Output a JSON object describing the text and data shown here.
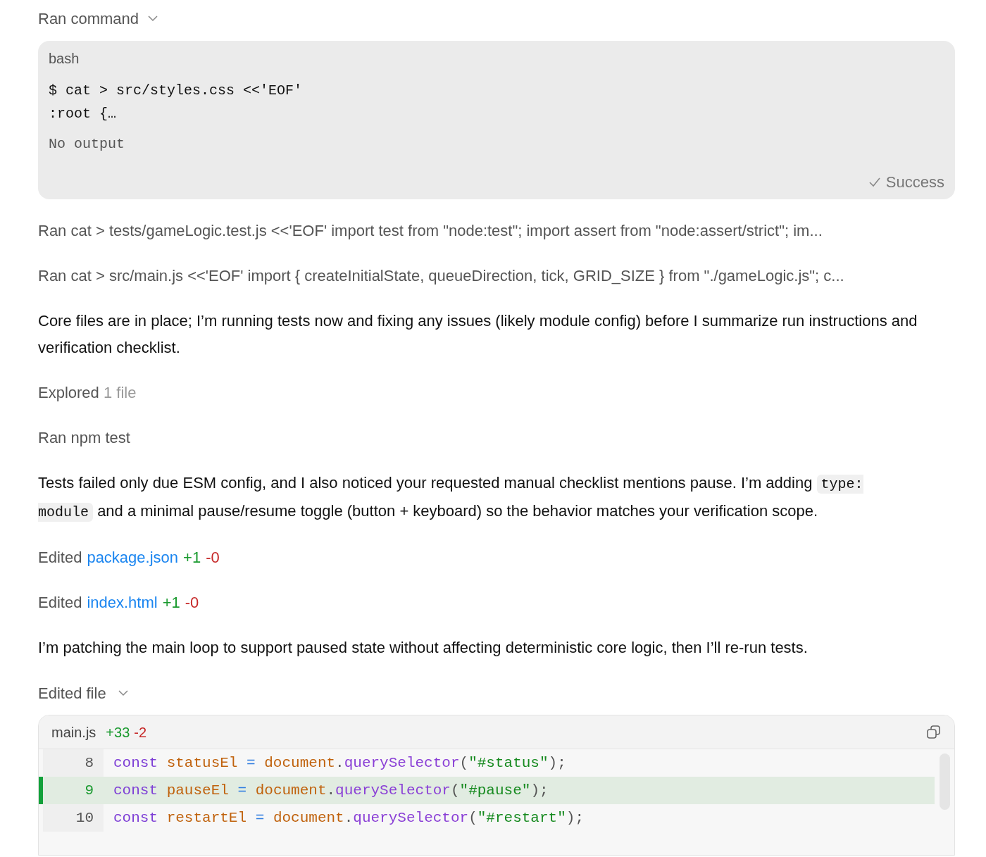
{
  "entries": [
    {
      "kind": "command",
      "header": "Ran command",
      "expanded": true,
      "language": "bash",
      "code_lines": [
        "$ cat > src/styles.css <<'EOF'",
        ":root {…"
      ],
      "output": "No output",
      "status": "Success"
    },
    {
      "kind": "summary",
      "text": "Ran cat > tests/gameLogic.test.js <<'EOF' import test from \"node:test\"; import assert from \"node:assert/strict\"; im..."
    },
    {
      "kind": "summary",
      "text": "Ran cat > src/main.js <<'EOF' import { createInitialState, queueDirection, tick, GRID_SIZE } from \"./gameLogic.js\"; c..."
    },
    {
      "kind": "message",
      "segments": [
        {
          "kind": "text",
          "text": "Core files are in place; I’m running tests now and fixing any issues (likely module config) before I summarize run instructions and verification checklist."
        }
      ]
    },
    {
      "kind": "explored",
      "verb": "Explored",
      "detail": "1 file"
    },
    {
      "kind": "summary",
      "text": "Ran npm test"
    },
    {
      "kind": "message",
      "segments": [
        {
          "kind": "text",
          "text": "Tests failed only due ESM config, and I also noticed your requested manual checklist mentions pause. I’m adding "
        },
        {
          "kind": "code",
          "text": "type: module"
        },
        {
          "kind": "text",
          "text": " and a minimal pause/resume toggle (button + keyboard) so the behavior matches your verification scope."
        }
      ]
    },
    {
      "kind": "edited",
      "verb": "Edited",
      "file": "package.json",
      "added": "+1",
      "removed": "-0"
    },
    {
      "kind": "edited",
      "verb": "Edited",
      "file": "index.html",
      "added": "+1",
      "removed": "-0"
    },
    {
      "kind": "message",
      "segments": [
        {
          "kind": "text",
          "text": "I’m patching the main loop to support paused state without affecting deterministic core logic, then I’ll re-run tests."
        }
      ]
    },
    {
      "kind": "diff",
      "header": "Edited file",
      "expanded": true,
      "file": "main.js",
      "added": "+33",
      "removed": "-2",
      "hunks": [
        {
          "lines": [
            {
              "number": "8",
              "kind": "context",
              "tokens": [
                {
                  "kind": "keyword",
                  "text": "const "
                },
                {
                  "kind": "variable",
                  "text": "statusEl "
                },
                {
                  "kind": "operator",
                  "text": "= "
                },
                {
                  "kind": "variable",
                  "text": "document"
                },
                {
                  "kind": "plain",
                  "text": "."
                },
                {
                  "kind": "function",
                  "text": "querySelector"
                },
                {
                  "kind": "plain",
                  "text": "("
                },
                {
                  "kind": "string",
                  "text": "\"#status\""
                },
                {
                  "kind": "plain",
                  "text": ");"
                }
              ]
            },
            {
              "number": "9",
              "kind": "added",
              "tokens": [
                {
                  "kind": "keyword",
                  "text": "const "
                },
                {
                  "kind": "variable",
                  "text": "pauseEl "
                },
                {
                  "kind": "operator",
                  "text": "= "
                },
                {
                  "kind": "variable",
                  "text": "document"
                },
                {
                  "kind": "plain",
                  "text": "."
                },
                {
                  "kind": "function",
                  "text": "querySelector"
                },
                {
                  "kind": "plain",
                  "text": "("
                },
                {
                  "kind": "string",
                  "text": "\"#pause\""
                },
                {
                  "kind": "plain",
                  "text": ");"
                }
              ]
            },
            {
              "number": "10",
              "kind": "context",
              "tokens": [
                {
                  "kind": "keyword",
                  "text": "const "
                },
                {
                  "kind": "variable",
                  "text": "restartEl "
                },
                {
                  "kind": "operator",
                  "text": "= "
                },
                {
                  "kind": "variable",
                  "text": "document"
                },
                {
                  "kind": "plain",
                  "text": "."
                },
                {
                  "kind": "function",
                  "text": "querySelector"
                },
                {
                  "kind": "plain",
                  "text": "("
                },
                {
                  "kind": "string",
                  "text": "\"#restart\""
                },
                {
                  "kind": "plain",
                  "text": ");"
                }
              ]
            }
          ]
        }
      ]
    }
  ]
}
